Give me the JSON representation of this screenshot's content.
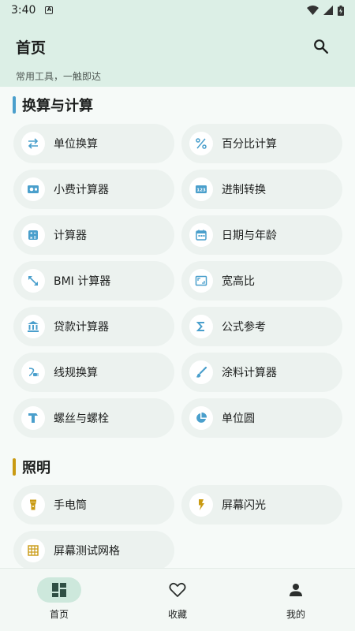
{
  "status": {
    "time": "3:40",
    "notif_badge": "A"
  },
  "header": {
    "title": "首页",
    "subtitle": "常用工具，一触即达"
  },
  "colors": {
    "accent_blue": "#4a9fcc",
    "accent_gold": "#c99a12",
    "header_bg": "#dcefe6",
    "nav_active_bg": "#cde8dc",
    "card_bg": "#ecf2ef"
  },
  "sections": [
    {
      "title": "换算与计算",
      "items": [
        {
          "label": "单位换算",
          "icon": "swap-arrows-icon"
        },
        {
          "label": "百分比计算",
          "icon": "percent-icon"
        },
        {
          "label": "小费计算器",
          "icon": "cash-icon"
        },
        {
          "label": "进制转换",
          "icon": "number-123-icon"
        },
        {
          "label": "计算器",
          "icon": "calculator-icon"
        },
        {
          "label": "日期与年龄",
          "icon": "calendar-icon"
        },
        {
          "label": "BMI 计算器",
          "icon": "diagonal-resize-icon"
        },
        {
          "label": "宽高比",
          "icon": "aspect-ratio-icon"
        },
        {
          "label": "贷款计算器",
          "icon": "bank-icon"
        },
        {
          "label": "公式参考",
          "icon": "sigma-icon"
        },
        {
          "label": "线规换算",
          "icon": "cable-icon"
        },
        {
          "label": "涂料计算器",
          "icon": "brush-icon"
        },
        {
          "label": "螺丝与螺栓",
          "icon": "hardware-bolt-icon"
        },
        {
          "label": "单位圆",
          "icon": "pie-chart-icon"
        }
      ]
    },
    {
      "title": "照明",
      "items": [
        {
          "label": "手电筒",
          "icon": "flashlight-icon"
        },
        {
          "label": "屏幕闪光",
          "icon": "flash-bolt-icon"
        },
        {
          "label": "屏幕测试网格",
          "icon": "grid-icon"
        }
      ]
    }
  ],
  "nav": {
    "home": "首页",
    "favorites": "收藏",
    "profile": "我的"
  }
}
